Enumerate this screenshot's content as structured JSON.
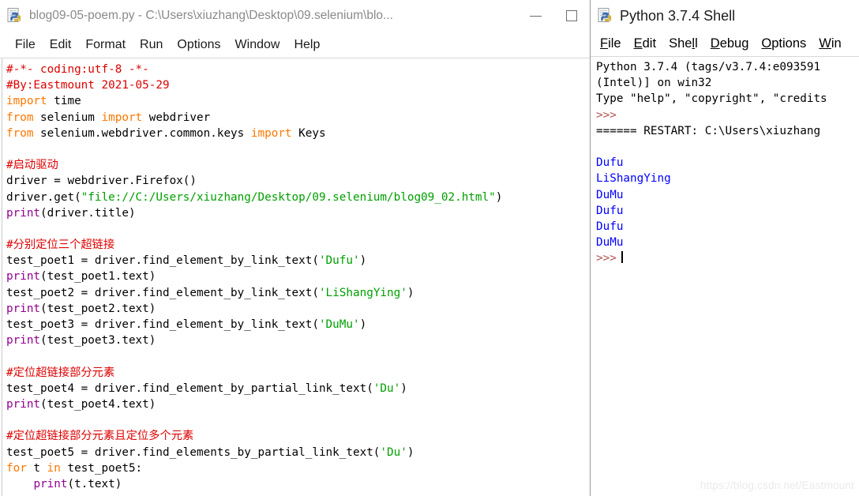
{
  "editor_window": {
    "icon": "python-idle-document-icon",
    "title": "blog09-05-poem.py - C:\\Users\\xiuzhang\\Desktop\\09.selenium\\blo...",
    "controls": {
      "minimize": "minimize-icon",
      "maximize": "maximize-icon"
    },
    "menu": [
      "File",
      "Edit",
      "Format",
      "Run",
      "Options",
      "Window",
      "Help"
    ],
    "code_lines": [
      [
        {
          "t": "#-*- coding:utf-8 -*-",
          "c": "cmt"
        }
      ],
      [
        {
          "t": "#By:Eastmount 2021-05-29",
          "c": "cmt"
        }
      ],
      [
        {
          "t": "import",
          "c": "kw"
        },
        {
          "t": " time",
          "c": ""
        }
      ],
      [
        {
          "t": "from",
          "c": "kw"
        },
        {
          "t": " selenium ",
          "c": ""
        },
        {
          "t": "import",
          "c": "kw"
        },
        {
          "t": " webdriver",
          "c": ""
        }
      ],
      [
        {
          "t": "from",
          "c": "kw"
        },
        {
          "t": " selenium.webdriver.common.keys ",
          "c": ""
        },
        {
          "t": "import",
          "c": "kw"
        },
        {
          "t": " Keys",
          "c": ""
        }
      ],
      [],
      [
        {
          "t": "#启动驱动",
          "c": "cmt"
        }
      ],
      [
        {
          "t": "driver = webdriver.Firefox()",
          "c": ""
        }
      ],
      [
        {
          "t": "driver.get(",
          "c": ""
        },
        {
          "t": "\"file://C:/Users/xiuzhang/Desktop/09.selenium/blog09_02.html\"",
          "c": "str"
        },
        {
          "t": ")",
          "c": ""
        }
      ],
      [
        {
          "t": "print",
          "c": "bi"
        },
        {
          "t": "(driver.title)",
          "c": ""
        }
      ],
      [],
      [
        {
          "t": "#分别定位三个超链接",
          "c": "cmt"
        }
      ],
      [
        {
          "t": "test_poet1 = driver.find_element_by_link_text(",
          "c": ""
        },
        {
          "t": "'Dufu'",
          "c": "str"
        },
        {
          "t": ")",
          "c": ""
        }
      ],
      [
        {
          "t": "print",
          "c": "bi"
        },
        {
          "t": "(test_poet1.text)",
          "c": ""
        }
      ],
      [
        {
          "t": "test_poet2 = driver.find_element_by_link_text(",
          "c": ""
        },
        {
          "t": "'LiShangYing'",
          "c": "str"
        },
        {
          "t": ")",
          "c": ""
        }
      ],
      [
        {
          "t": "print",
          "c": "bi"
        },
        {
          "t": "(test_poet2.text)",
          "c": ""
        }
      ],
      [
        {
          "t": "test_poet3 = driver.find_element_by_link_text(",
          "c": ""
        },
        {
          "t": "'DuMu'",
          "c": "str"
        },
        {
          "t": ")",
          "c": ""
        }
      ],
      [
        {
          "t": "print",
          "c": "bi"
        },
        {
          "t": "(test_poet3.text)",
          "c": ""
        }
      ],
      [],
      [
        {
          "t": "#定位超链接部分元素",
          "c": "cmt"
        }
      ],
      [
        {
          "t": "test_poet4 = driver.find_element_by_partial_link_text(",
          "c": ""
        },
        {
          "t": "'Du'",
          "c": "str"
        },
        {
          "t": ")",
          "c": ""
        }
      ],
      [
        {
          "t": "print",
          "c": "bi"
        },
        {
          "t": "(test_poet4.text)",
          "c": ""
        }
      ],
      [],
      [
        {
          "t": "#定位超链接部分元素且定位多个元素",
          "c": "cmt"
        }
      ],
      [
        {
          "t": "test_poet5 = driver.find_elements_by_partial_link_text(",
          "c": ""
        },
        {
          "t": "'Du'",
          "c": "str"
        },
        {
          "t": ")",
          "c": ""
        }
      ],
      [
        {
          "t": "for",
          "c": "kw"
        },
        {
          "t": " t ",
          "c": ""
        },
        {
          "t": "in",
          "c": "kw"
        },
        {
          "t": " test_poet5:",
          "c": ""
        }
      ],
      [
        {
          "t": "    ",
          "c": ""
        },
        {
          "t": "print",
          "c": "bi"
        },
        {
          "t": "(t.text)",
          "c": ""
        }
      ]
    ]
  },
  "shell_window": {
    "icon": "python-idle-document-icon",
    "title": "Python 3.7.4 Shell",
    "menu": [
      {
        "label": "File",
        "mnemonic": "F"
      },
      {
        "label": "Edit",
        "mnemonic": "E"
      },
      {
        "label": "Shell",
        "mnemonic": "l"
      },
      {
        "label": "Debug",
        "mnemonic": "D"
      },
      {
        "label": "Options",
        "mnemonic": "O"
      },
      {
        "label": "Win",
        "mnemonic": "W"
      }
    ],
    "output_lines": [
      [
        {
          "t": "Python 3.7.4 (tags/v3.7.4:e093591",
          "c": ""
        }
      ],
      [
        {
          "t": "(Intel)] on win32",
          "c": ""
        }
      ],
      [
        {
          "t": "Type \"help\", \"copyright\", \"credits",
          "c": ""
        }
      ],
      [
        {
          "t": ">>>",
          "c": "prompt"
        }
      ],
      [
        {
          "t": "====== RESTART: C:\\Users\\xiuzhang",
          "c": ""
        }
      ],
      [],
      [
        {
          "t": "Dufu",
          "c": "out"
        }
      ],
      [
        {
          "t": "LiShangYing",
          "c": "out"
        }
      ],
      [
        {
          "t": "DuMu",
          "c": "out"
        }
      ],
      [
        {
          "t": "Dufu",
          "c": "out"
        }
      ],
      [
        {
          "t": "Dufu",
          "c": "out"
        }
      ],
      [
        {
          "t": "DuMu",
          "c": "out"
        }
      ],
      [
        {
          "t": ">>>",
          "c": "prompt",
          "cursor": true
        }
      ]
    ]
  },
  "watermark": {
    "text": "https://blog.csdn.net/Eastmount"
  },
  "colors": {
    "keyword": "#ff7700",
    "builtin": "#900090",
    "string": "#00a000",
    "comment": "#dd0000",
    "shell_output": "#0000ff",
    "shell_prompt": "#b05050"
  }
}
